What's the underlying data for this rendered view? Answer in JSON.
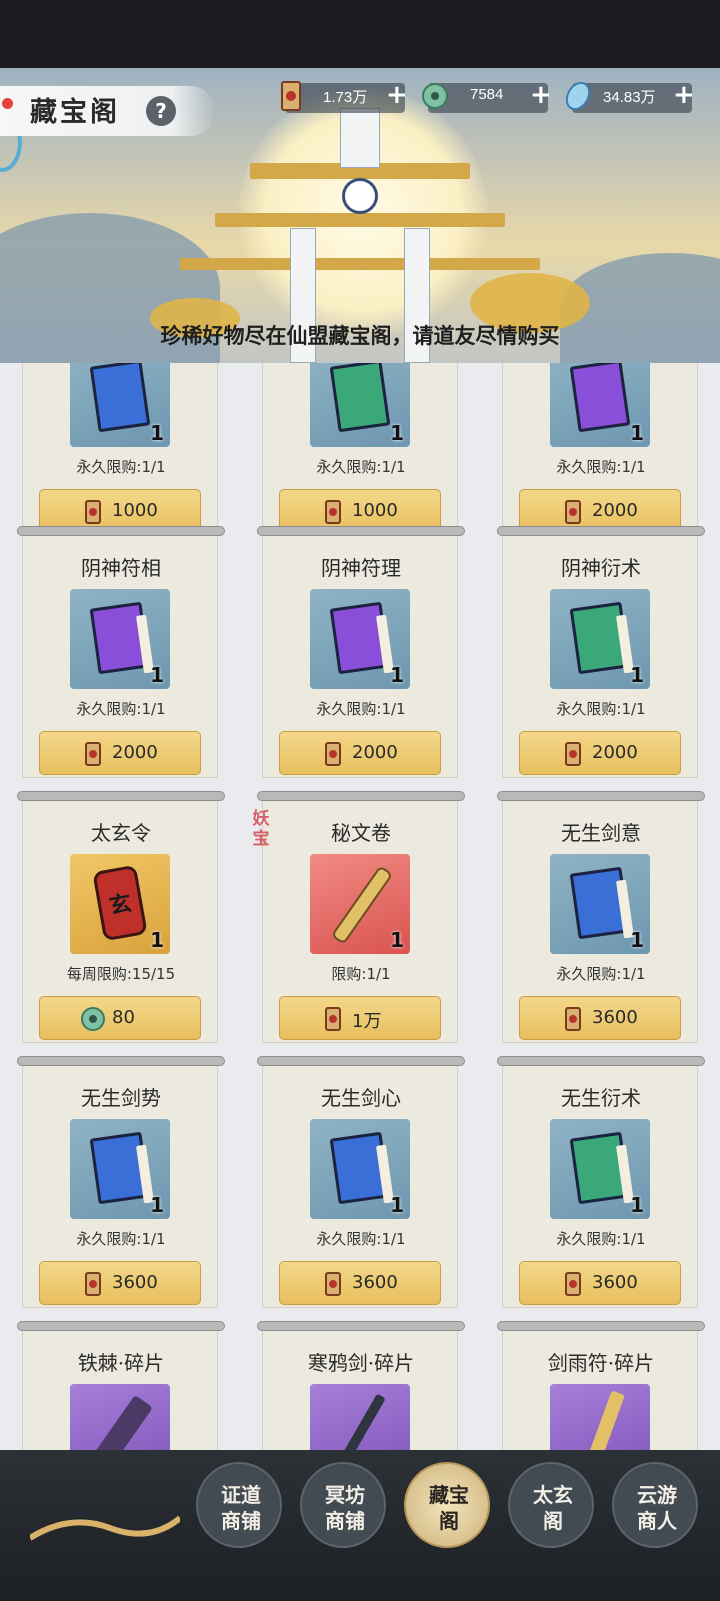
{
  "header": {
    "title": "藏宝阁",
    "help_label": "?",
    "tagline": "珍稀好物尽在仙盟藏宝阁，请道友尽情购买"
  },
  "currencies": [
    {
      "icon": "scroll-token-icon",
      "value": "1.73万",
      "plus": "+"
    },
    {
      "icon": "jade-coin-icon",
      "value": "7584",
      "plus": "+"
    },
    {
      "icon": "spirit-crystal-icon",
      "value": "34.83万",
      "plus": "+"
    }
  ],
  "colors": {
    "blue_book": "#3a6fd8",
    "green_book": "#3aa878",
    "purple_book": "#8a4fd8",
    "gold_button": "#e8bf5d",
    "red_token": "#c0302a"
  },
  "partial_row": [
    {
      "limit": "永久限购:1/1",
      "qty": "1",
      "price": "1000",
      "currency": "scroll-token-icon",
      "book": "blue"
    },
    {
      "limit": "永久限购:1/1",
      "qty": "1",
      "price": "1000",
      "currency": "scroll-token-icon",
      "book": "green"
    },
    {
      "limit": "永久限购:1/1",
      "qty": "1",
      "price": "2000",
      "currency": "scroll-token-icon",
      "book": "purple"
    }
  ],
  "items": [
    {
      "name": "阴神符相",
      "limit": "永久限购:1/1",
      "qty": "1",
      "price": "2000",
      "currency": "scroll-token-icon",
      "book": "purple"
    },
    {
      "name": "阴神符理",
      "limit": "永久限购:1/1",
      "qty": "1",
      "price": "2000",
      "currency": "scroll-token-icon",
      "book": "purple"
    },
    {
      "name": "阴神衍术",
      "limit": "永久限购:1/1",
      "qty": "1",
      "price": "2000",
      "currency": "scroll-token-icon",
      "book": "green"
    },
    {
      "name": "太玄令",
      "limit": "每周限购:15/15",
      "qty": "1",
      "price": "80",
      "currency": "jade-coin-icon",
      "book": "token"
    },
    {
      "name": "秘文卷",
      "limit": "限购:1/1",
      "qty": "1",
      "price": "1万",
      "currency": "scroll-token-icon",
      "book": "scroll",
      "tag": "妖宝"
    },
    {
      "name": "无生剑意",
      "limit": "永久限购:1/1",
      "qty": "1",
      "price": "3600",
      "currency": "scroll-token-icon",
      "book": "blue"
    },
    {
      "name": "无生剑势",
      "limit": "永久限购:1/1",
      "qty": "1",
      "price": "3600",
      "currency": "scroll-token-icon",
      "book": "blue"
    },
    {
      "name": "无生剑心",
      "limit": "永久限购:1/1",
      "qty": "1",
      "price": "3600",
      "currency": "scroll-token-icon",
      "book": "blue"
    },
    {
      "name": "无生衍术",
      "limit": "永久限购:1/1",
      "qty": "1",
      "price": "3600",
      "currency": "scroll-token-icon",
      "book": "green"
    },
    {
      "name": "铁棘·碎片",
      "book": "weapon"
    },
    {
      "name": "寒鸦剑·碎片",
      "book": "weapon"
    },
    {
      "name": "剑雨符·碎片",
      "book": "weapon"
    }
  ],
  "token_glyph": "玄",
  "bottom_nav": [
    {
      "label": "证道\n商铺",
      "active": false
    },
    {
      "label": "冥坊\n商铺",
      "active": false
    },
    {
      "label": "藏宝\n阁",
      "active": true
    },
    {
      "label": "太玄\n阁",
      "active": false
    },
    {
      "label": "云游\n商人",
      "active": false
    }
  ]
}
